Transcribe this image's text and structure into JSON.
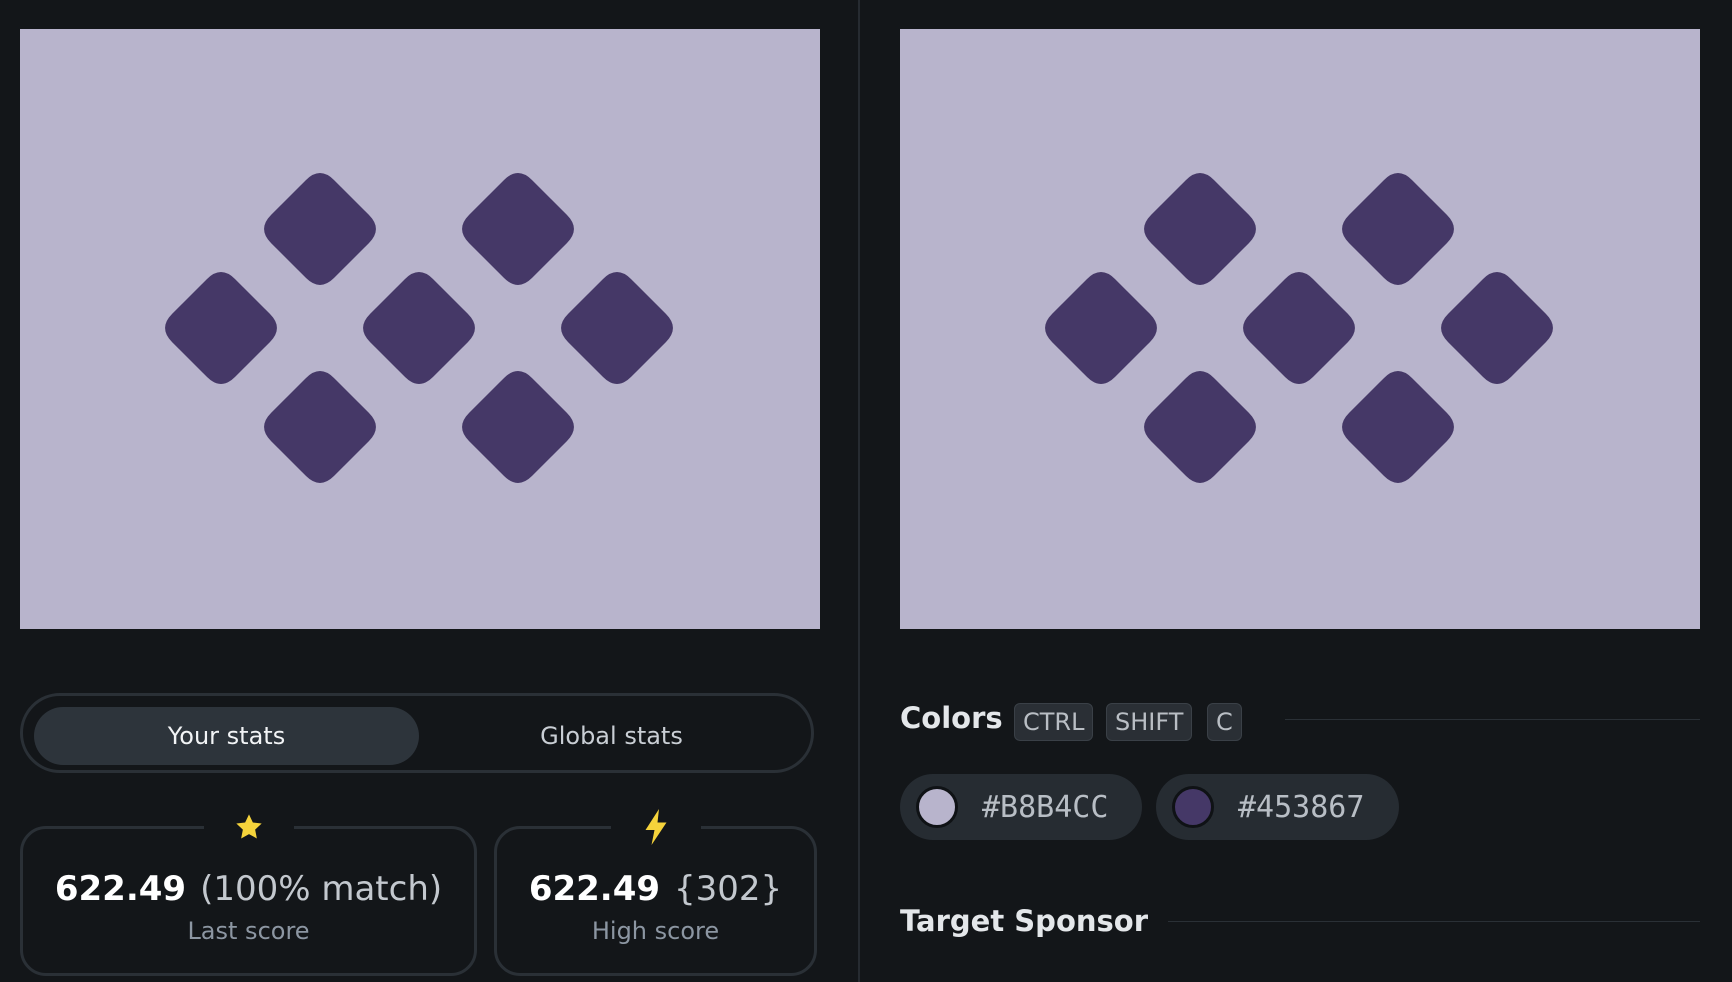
{
  "canvases": {
    "output": {
      "background": "#B8B4CC",
      "shape_color": "#453867",
      "shape": "rounded-diamond",
      "count": 7
    },
    "target": {
      "background": "#B8B4CC",
      "shape_color": "#453867",
      "shape": "rounded-diamond",
      "count": 7
    }
  },
  "stats_toggle": {
    "your_stats": "Your stats",
    "global_stats": "Global stats",
    "active": "Your stats"
  },
  "last_score": {
    "icon": "star-icon",
    "icon_color": "#F5D33B",
    "value": "622.49",
    "detail": "(100% match)",
    "label": "Last score"
  },
  "high_score": {
    "icon": "lightning-icon",
    "icon_color": "#F5D33B",
    "value": "622.49",
    "detail": "{302}",
    "label": "High score"
  },
  "colors": {
    "title": "Colors",
    "shortcut": [
      "CTRL",
      "SHIFT",
      "C"
    ],
    "swatches": [
      {
        "hex": "#B8B4CC"
      },
      {
        "hex": "#453867"
      }
    ]
  },
  "sponsor": {
    "title": "Target Sponsor"
  }
}
